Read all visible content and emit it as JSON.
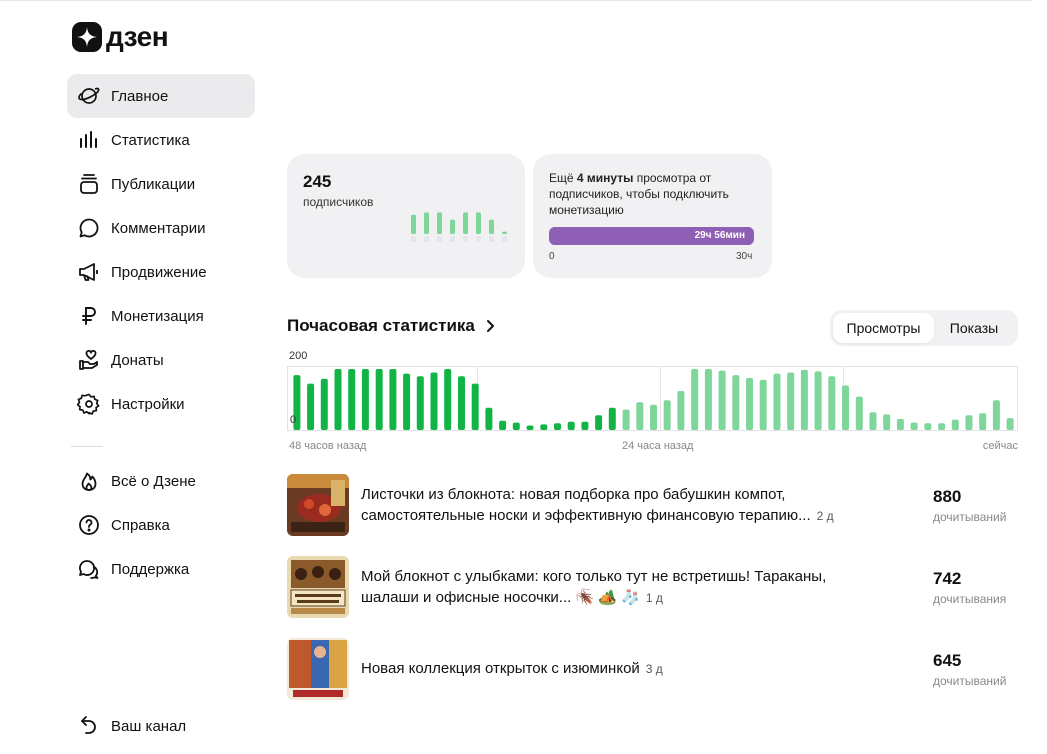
{
  "brand": {
    "name": "дзен"
  },
  "sidebar": {
    "items": [
      {
        "label": "Главное",
        "icon": "planet-icon",
        "active": true
      },
      {
        "label": "Статистика",
        "icon": "bar-chart-icon"
      },
      {
        "label": "Публикации",
        "icon": "stack-icon"
      },
      {
        "label": "Комментарии",
        "icon": "comment-icon"
      },
      {
        "label": "Продвижение",
        "icon": "megaphone-icon"
      },
      {
        "label": "Монетизация",
        "icon": "ruble-icon"
      },
      {
        "label": "Донаты",
        "icon": "heart-hand-icon"
      },
      {
        "label": "Настройки",
        "icon": "gear-icon"
      }
    ],
    "secondary": [
      {
        "label": "Всё о Дзене",
        "icon": "flame-icon"
      },
      {
        "label": "Справка",
        "icon": "help-icon"
      },
      {
        "label": "Поддержка",
        "icon": "chat-icon"
      }
    ],
    "channel_label": "Ваш канал"
  },
  "subscribers": {
    "count": "245",
    "label": "подписчиков",
    "mini_bars": [
      16,
      18,
      18,
      12,
      18,
      18,
      12,
      2
    ]
  },
  "monetization": {
    "prefix": "Ещё ",
    "emph": "4 минуты",
    "suffix": " просмотра от подписчиков, чтобы подключить монетизацию",
    "progress_label": "29ч 56мин",
    "progress_value": 1.0,
    "min_label": "0",
    "max_label": "30ч"
  },
  "hourly": {
    "title": "Почасовая статистика",
    "tabs": [
      {
        "label": "Просмотры",
        "active": true
      },
      {
        "label": "Показы",
        "active": false
      }
    ]
  },
  "chart_data": {
    "type": "bar",
    "ylabel_top": "200",
    "ylabel_bottom": "0",
    "ylim": [
      0,
      200
    ],
    "x_labels": [
      "48 часов назад",
      "24 часа назад",
      "сейчас"
    ],
    "colors": {
      "past": "#12b545",
      "recent": "#7fd69b"
    },
    "past_count": 24,
    "values": [
      148,
      125,
      138,
      165,
      165,
      168,
      175,
      165,
      152,
      145,
      155,
      175,
      145,
      125,
      60,
      25,
      20,
      12,
      15,
      18,
      22,
      22,
      40,
      60,
      55,
      75,
      68,
      80,
      105,
      170,
      165,
      160,
      148,
      140,
      135,
      152,
      155,
      162,
      158,
      145,
      120,
      90,
      48,
      42,
      30,
      20,
      18,
      18,
      28,
      40,
      45,
      80,
      32
    ],
    "grid": true
  },
  "articles": [
    {
      "title": "Листочки из блокнота: новая подборка про бабушкин компот, самостоятельные носки и эффективную финансовую терапию...",
      "age": "2 д",
      "count": "880",
      "count_label": "дочитываний"
    },
    {
      "title": "Мой блокнот с улыбками: кого только тут не встретишь! Тараканы, шалаши и офисные носочки... 🪳 🏕️ 🧦",
      "age": "1 д",
      "count": "742",
      "count_label": "дочитывания"
    },
    {
      "title": "Новая коллекция открыток с изюминкой",
      "age": "3 д",
      "count": "645",
      "count_label": "дочитываний"
    }
  ]
}
